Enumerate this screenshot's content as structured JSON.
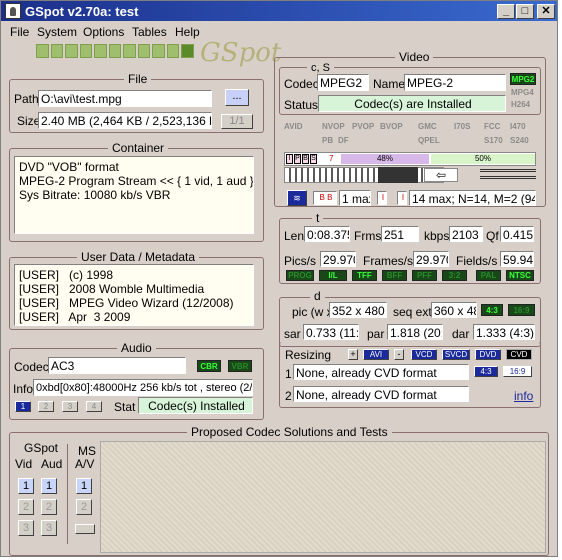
{
  "window": {
    "title": "GSpot v2.70a: test",
    "min": "_",
    "max": "□",
    "close": "✕"
  },
  "menu": [
    "File",
    "System",
    "Options",
    "Tables",
    "Help"
  ],
  "logo": "GSpot",
  "file": {
    "title": "File",
    "path_label": "Path",
    "path_value": "O:\\avi\\test.mpg",
    "browse": "...",
    "size_label": "Size",
    "size_value": "2.40 MB (2,464 KB / 2,523,136 byt",
    "page": "1/1"
  },
  "container": {
    "title": "Container",
    "text": "DVD \"VOB\" format\nMPEG-2 Program Stream << { 1 vid, 1 aud }\nSys Bitrate: 10080 kb/s VBR"
  },
  "userdata": {
    "title": "User Data / Metadata",
    "text": "[USER]   (c) 1998\n[USER]   2008 Womble Multimedia\n[USER]   MPEG Video Wizard (12/2008)\n[USER]   Apr  3 2009"
  },
  "audio": {
    "title": "Audio",
    "codec_label": "Codec",
    "codec_value": "AC3",
    "cbr": "CBR",
    "vbr": "VBR",
    "info_label": "Info",
    "info_value": "0xbd[0x80]:48000Hz  256 kb/s tot , stereo (2/",
    "streams": [
      "1",
      "2",
      "3",
      "4"
    ],
    "stat_label": "Stat",
    "stat_value": "Codec(s) Installed"
  },
  "proposed": {
    "title": "Proposed Codec Solutions and Tests",
    "gspot": "GSpot",
    "vid": "Vid",
    "aud": "Aud",
    "ms": "MS",
    "av": "A/V",
    "vid_btns": [
      "1",
      "2",
      "3"
    ],
    "aud_btns": [
      "1",
      "2",
      "3"
    ],
    "ms_btns": [
      "1",
      "2"
    ]
  },
  "video": {
    "title": "Video",
    "cs": "c, S",
    "codec_label": "Codec",
    "codec_value": "MPEG2",
    "name_label": "Name",
    "name_value": "MPEG-2",
    "status_label": "Status",
    "status_value": "Codec(s) are Installed",
    "mpg2": "MPG2",
    "mpg4": "MPG4",
    "h264": "H264",
    "flags_row1": [
      "AVID",
      "NVOP",
      "PVOP",
      "BVOP",
      "GMC",
      "I70S",
      "FCC",
      "I470"
    ],
    "flags_row2": [
      "PB",
      "DF",
      "QPEL",
      "S170",
      "S240"
    ],
    "frames": [
      "I",
      "P",
      "B",
      "S"
    ],
    "seven": "7",
    "pct1": "48%",
    "pct2": "50%",
    "gop_bb": "B B",
    "max1": "1 max",
    "gop_ii": "I",
    "max_text": "14 max; N=14, M=2 (94%"
  },
  "t": {
    "title": "t",
    "len_label": "Len",
    "len_value": "0:08.375",
    "frms_label": "Frms",
    "frms_value": "251",
    "kbps_label": "kbps",
    "kbps_value": "2103",
    "qf_label": "Qf",
    "qf_value": "0.415",
    "pics_label": "Pics/s",
    "pics_value": "29.970",
    "frames_label": "Frames/s",
    "frames_value": "29.970",
    "fields_label": "Fields/s",
    "fields_value": "59.94",
    "badges": [
      "PROG",
      "I/L",
      "TFF",
      "BFF",
      "PFF",
      "3:2",
      "PAL",
      "NTSC"
    ],
    "badge_on": [
      false,
      true,
      true,
      false,
      false,
      false,
      false,
      true
    ]
  },
  "d": {
    "title": "d",
    "pic_label": "pic (w x",
    "pic_value": "352 x 480",
    "seq_label": "seq ext",
    "seq_value": "360 x 48",
    "r43": "4:3",
    "r169": "16:9",
    "sar_label": "sar",
    "sar_value": "0.733 (11:1",
    "par_label": "par",
    "par_value": "1.818 (20:1",
    "dar_label": "dar",
    "dar_value": "1.333 (4:3)"
  },
  "resizing": {
    "label": "Resizing",
    "plus": "+",
    "avi": "AVI",
    "minus": "-",
    "btns": [
      "VCD",
      "SVCD",
      "DVD",
      "CVD"
    ],
    "row1_num": "1",
    "row1_value": "None, already CVD format",
    "r43": "4:3",
    "r169": "16:9",
    "row2_num": "2",
    "row2_value": "None, already CVD format",
    "info": "info"
  }
}
